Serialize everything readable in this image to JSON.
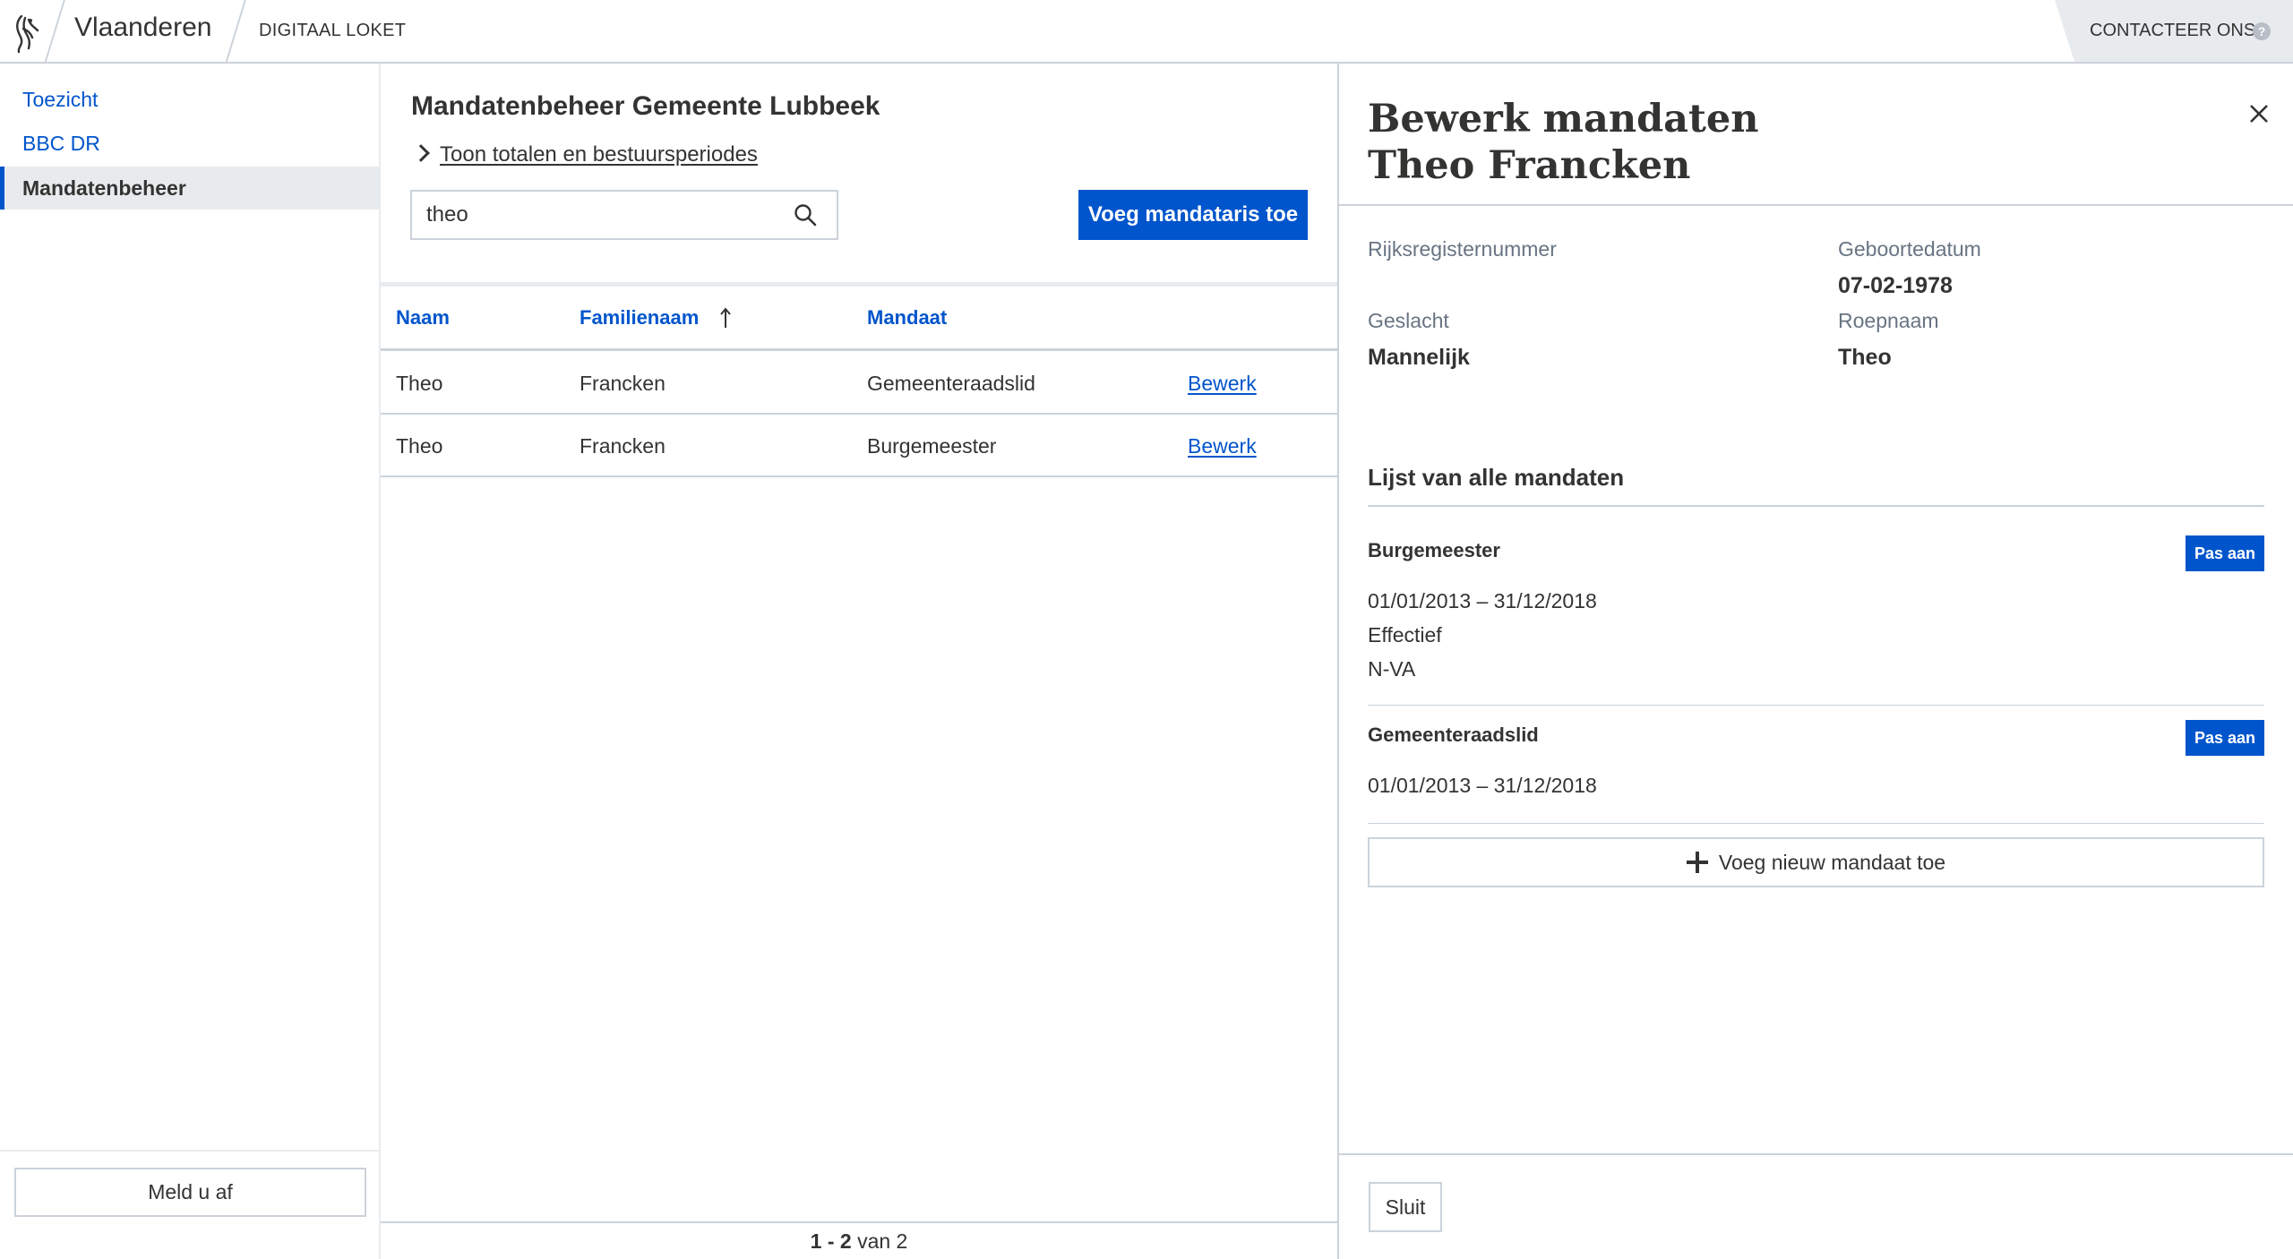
{
  "header": {
    "brand": "Vlaanderen",
    "host": "DIGITAAL LOKET",
    "contact_label": "CONTACTEER ONS",
    "help_glyph": "?"
  },
  "sidebar": {
    "items": [
      {
        "label": "Toezicht",
        "active": false
      },
      {
        "label": "BBC DR",
        "active": false
      },
      {
        "label": "Mandatenbeheer",
        "active": true
      }
    ],
    "logout_label": "Meld u af"
  },
  "main": {
    "title": "Mandatenbeheer Gemeente Lubbeek",
    "toggle_label": "Toon totalen en bestuursperiodes",
    "search": {
      "value": "theo",
      "placeholder": ""
    },
    "add_button": "Voeg mandataris toe",
    "table": {
      "columns": [
        "Naam",
        "Familienaam",
        "Mandaat"
      ],
      "sort_column": "Familienaam",
      "sort_direction": "ascending",
      "rows": [
        {
          "naam": "Theo",
          "familienaam": "Francken",
          "mandaat": "Gemeenteraadslid",
          "action": "Bewerk"
        },
        {
          "naam": "Theo",
          "familienaam": "Francken",
          "mandaat": "Burgemeester",
          "action": "Bewerk"
        }
      ]
    },
    "pager": {
      "range": "1 - 2",
      "suffix": "van 2"
    }
  },
  "panel": {
    "title_line1": "Bewerk mandaten",
    "title_line2": "Theo Francken",
    "fields": {
      "rijksregister_label": "Rijksregisternummer",
      "rijksregister_value": "",
      "geboortedatum_label": "Geboortedatum",
      "geboortedatum_value": "07-02-1978",
      "geslacht_label": "Geslacht",
      "geslacht_value": "Mannelijk",
      "roepnaam_label": "Roepnaam",
      "roepnaam_value": "Theo"
    },
    "mandates_title": "Lijst van alle mandaten",
    "mandates": [
      {
        "name": "Burgemeester",
        "period": "01/01/2013 – 31/12/2018",
        "status": "Effectief",
        "party": "N-VA",
        "button": "Pas aan"
      },
      {
        "name": "Gemeenteraadslid",
        "period": "01/01/2013 – 31/12/2018",
        "button": "Pas aan"
      }
    ],
    "add_mandate_label": "Voeg nieuw mandaat toe",
    "close_label": "Sluit"
  },
  "colors": {
    "primary": "#0055cc",
    "border": "#cbd2da",
    "muted_bg": "#e8ebee",
    "text": "#333332",
    "label_text": "#687483"
  }
}
